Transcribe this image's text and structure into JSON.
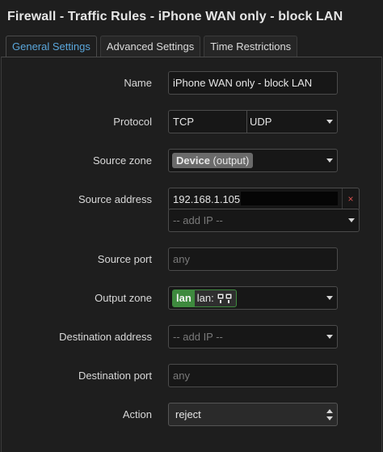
{
  "window": {
    "title": "Firewall - Traffic Rules - iPhone WAN only - block LAN"
  },
  "tabs": [
    {
      "label": "General Settings",
      "active": true
    },
    {
      "label": "Advanced Settings",
      "active": false
    },
    {
      "label": "Time Restrictions",
      "active": false
    }
  ],
  "form": {
    "name": {
      "label": "Name",
      "value": "iPhone WAN only - block LAN"
    },
    "protocol": {
      "label": "Protocol",
      "values": [
        "TCP",
        "UDP"
      ]
    },
    "source_zone": {
      "label": "Source zone",
      "chip_name": "Device",
      "chip_note": "(output)"
    },
    "source_address": {
      "label": "Source address",
      "value": "192.168.1.105",
      "remove_symbol": "×",
      "add_placeholder": "-- add IP --"
    },
    "source_port": {
      "label": "Source port",
      "placeholder": "any"
    },
    "output_zone": {
      "label": "Output zone",
      "chip_tag": "lan",
      "chip_text": "lan:"
    },
    "destination_address": {
      "label": "Destination address",
      "placeholder": "-- add IP --"
    },
    "destination_port": {
      "label": "Destination port",
      "placeholder": "any"
    },
    "action": {
      "label": "Action",
      "value": "reject"
    }
  },
  "colors": {
    "background": "#1e1e1e",
    "active_tab": "#5aa7dc",
    "zone_lan": "#3e8a3e",
    "remove": "#d9534f"
  }
}
